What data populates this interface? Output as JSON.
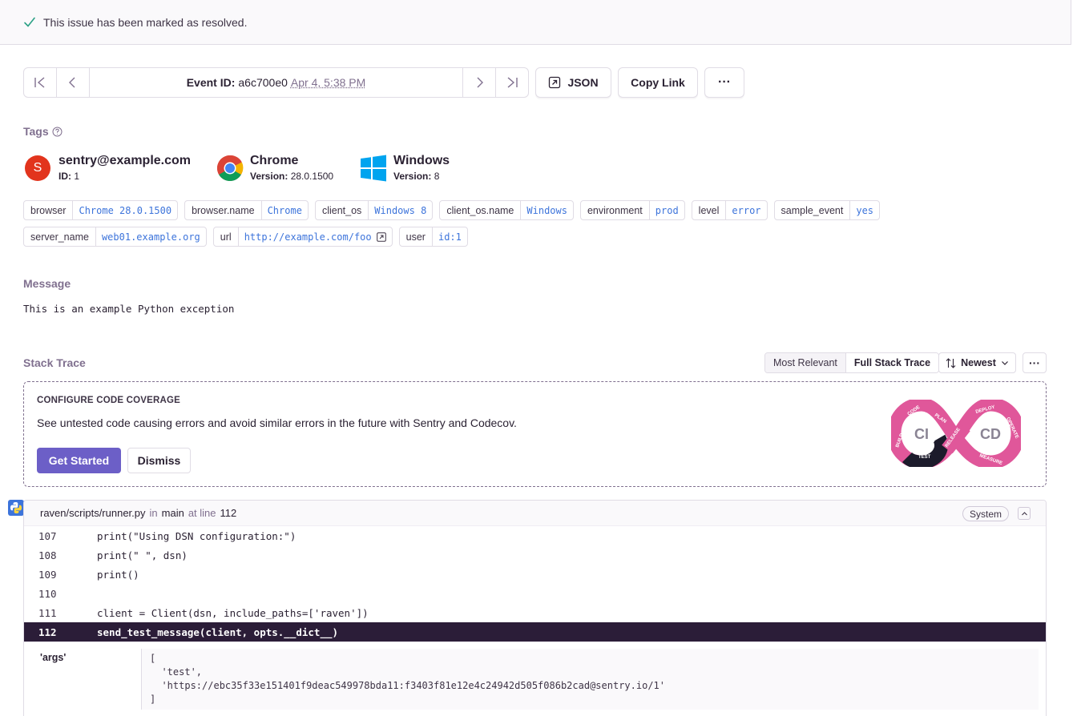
{
  "banner": {
    "text": "This issue has been marked as resolved."
  },
  "event_nav": {
    "label": "Event ID:",
    "event_id": "a6c700e0",
    "date": "Apr 4, 5:38 PM"
  },
  "toolbar": {
    "json_label": "JSON",
    "copy_link_label": "Copy Link",
    "more_label": "···"
  },
  "tags_section": {
    "title": "Tags"
  },
  "contexts": [
    {
      "name": "sentry@example.com",
      "sub_label": "ID:",
      "sub_value": "1",
      "avatar_letter": "S"
    },
    {
      "name": "Chrome",
      "sub_label": "Version:",
      "sub_value": "28.0.1500"
    },
    {
      "name": "Windows",
      "sub_label": "Version:",
      "sub_value": "8"
    }
  ],
  "tags": [
    {
      "key": "browser",
      "value": "Chrome 28.0.1500"
    },
    {
      "key": "browser.name",
      "value": "Chrome"
    },
    {
      "key": "client_os",
      "value": "Windows 8"
    },
    {
      "key": "client_os.name",
      "value": "Windows"
    },
    {
      "key": "environment",
      "value": "prod"
    },
    {
      "key": "level",
      "value": "error"
    },
    {
      "key": "sample_event",
      "value": "yes"
    },
    {
      "key": "server_name",
      "value": "web01.example.org"
    },
    {
      "key": "url",
      "value": "http://example.com/foo"
    },
    {
      "key": "user",
      "value": "id:1"
    }
  ],
  "message_section": {
    "title": "Message",
    "text": "This is an example Python exception"
  },
  "stack": {
    "title": "Stack Trace",
    "seg_most_relevant": "Most Relevant",
    "seg_full": "Full Stack Trace",
    "sort_label": "Newest",
    "more_label": "···"
  },
  "coverage": {
    "heading": "CONFIGURE CODE COVERAGE",
    "description": "See untested code causing errors and avoid similar errors in the future with Sentry and Codecov.",
    "get_started": "Get Started",
    "dismiss": "Dismiss",
    "logo": {
      "ci": "CI",
      "cd": "CD",
      "code": "CODE",
      "plan": "PLAN",
      "build": "BUILD",
      "test": "TEST",
      "release": "RELEASE",
      "deploy": "DEPLOY",
      "operate": "OPERATE",
      "measure": "MEASURE"
    }
  },
  "frame": {
    "file": "raven/scripts/runner.py",
    "in_label": "in",
    "function": "main",
    "at_line_label": "at line",
    "line": "112",
    "system_label": "System",
    "lines": [
      {
        "num": "107",
        "code": "print(\"Using DSN configuration:\")"
      },
      {
        "num": "108",
        "code": "print(\" \", dsn)"
      },
      {
        "num": "109",
        "code": "print()"
      },
      {
        "num": "110",
        "code": ""
      },
      {
        "num": "111",
        "code": "client = Client(dsn, include_paths=['raven'])"
      },
      {
        "num": "112",
        "code": "send_test_message(client, opts.__dict__)"
      }
    ],
    "var_key": "'args'",
    "var_lines": [
      "[",
      "  'test',",
      "  'https://ebc35f33e151401f9deac549978bda11:f3403f81e12e4c24942d505f086b2cad@sentry.io/1'",
      "]"
    ]
  },
  "colors": {
    "accent": "#6c5fc7",
    "link": "#3d74db",
    "highlight_row": "#2b1d38",
    "avatar": "#e2341d",
    "success": "#2ba185"
  }
}
